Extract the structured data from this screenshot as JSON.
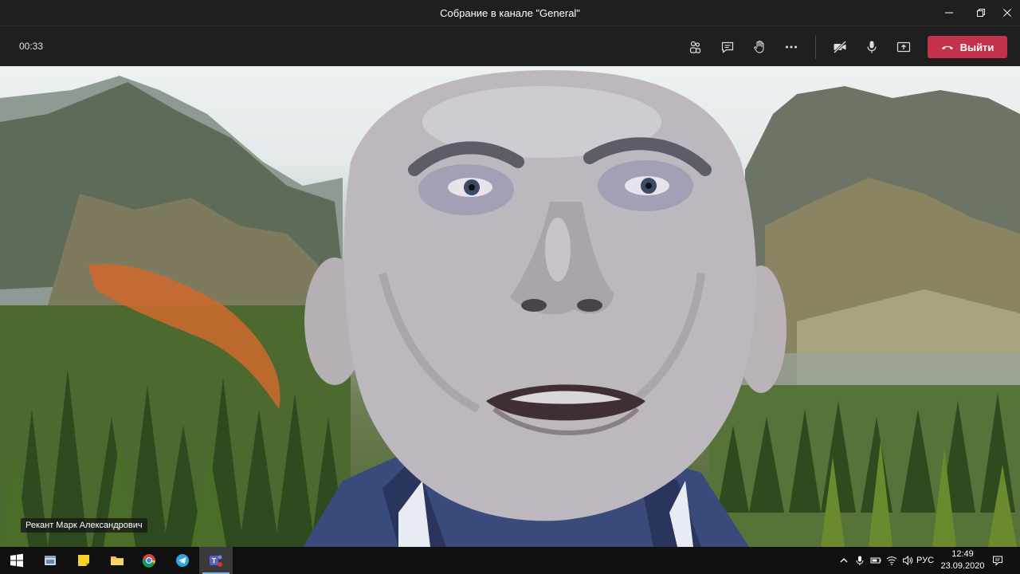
{
  "window": {
    "title": "Собрание в канале \"General\""
  },
  "toolbar": {
    "timer": "00:33",
    "leave_label": "Выйти",
    "icons": [
      "participants-icon",
      "chat-icon",
      "raise-hand-icon",
      "more-icon",
      "camera-off-icon",
      "microphone-icon",
      "share-screen-icon"
    ],
    "leave_color": "#c4314b"
  },
  "video": {
    "participant_name": "Рекант Марк Александрович"
  },
  "taskbar": {
    "apps": [
      "windows-start-icon",
      "file-manager-icon",
      "sticky-notes-icon",
      "file-explorer-icon",
      "chrome-icon",
      "telegram-icon",
      "teams-icon"
    ],
    "language": "РУС",
    "time": "12:49",
    "date": "23.09.2020"
  }
}
